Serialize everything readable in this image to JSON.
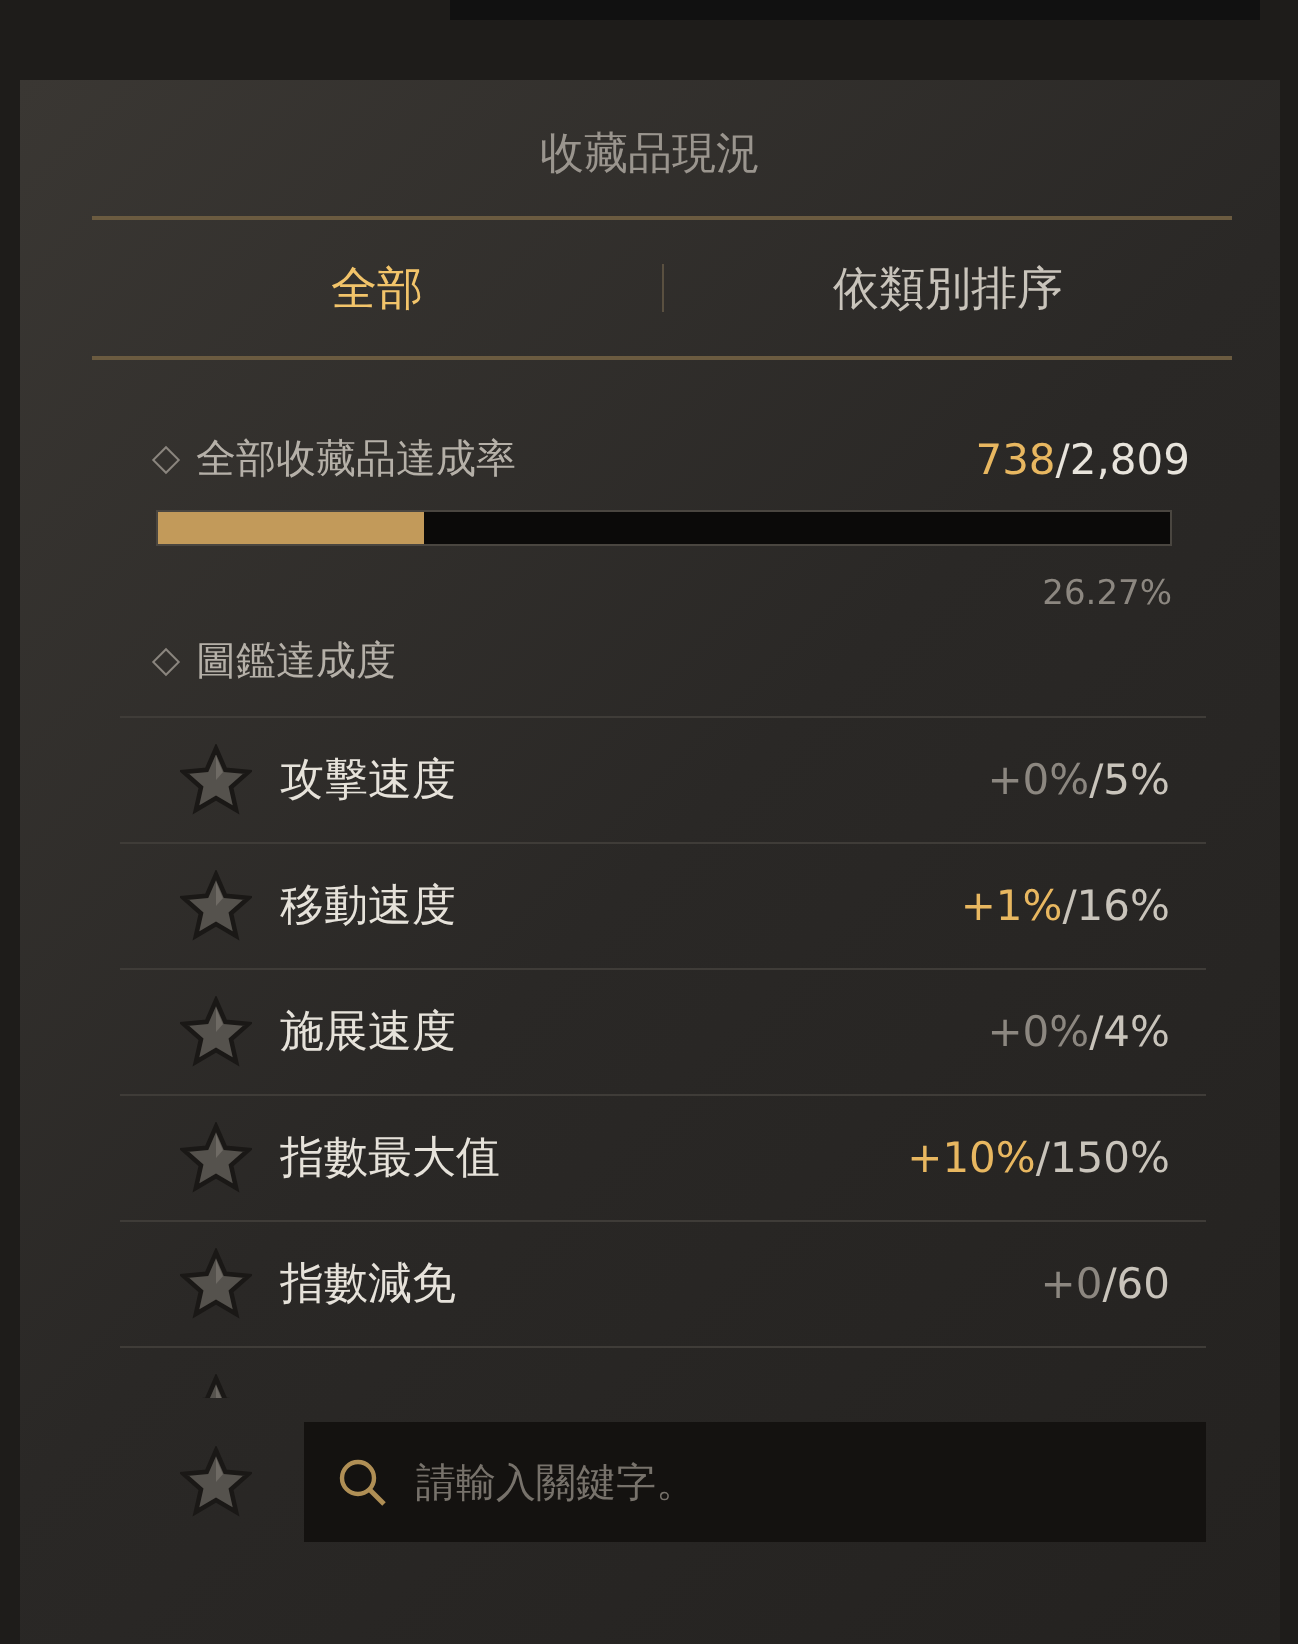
{
  "panel": {
    "title": "收藏品現況"
  },
  "tabs": [
    {
      "label": "全部",
      "selected": true
    },
    {
      "label": "依類別排序",
      "selected": false
    }
  ],
  "overall": {
    "label": "全部收藏品達成率",
    "collected": "738",
    "total": "/2,809",
    "level": 0.2627,
    "percent": "26.27%"
  },
  "codex": {
    "label": "圖鑑達成度"
  },
  "stats": [
    {
      "name": "攻擊速度",
      "bonus": "+0%",
      "max": "/5%",
      "active": false
    },
    {
      "name": "移動速度",
      "bonus": "+1%",
      "max": "/16%",
      "active": true
    },
    {
      "name": "施展速度",
      "bonus": "+0%",
      "max": "/4%",
      "active": false
    },
    {
      "name": "指數最大值",
      "bonus": "+10%",
      "max": "/150%",
      "active": true
    },
    {
      "name": "指數減免",
      "bonus": "+0",
      "max": "/60",
      "active": false
    }
  ],
  "search": {
    "placeholder": "請輸入關鍵字。"
  }
}
